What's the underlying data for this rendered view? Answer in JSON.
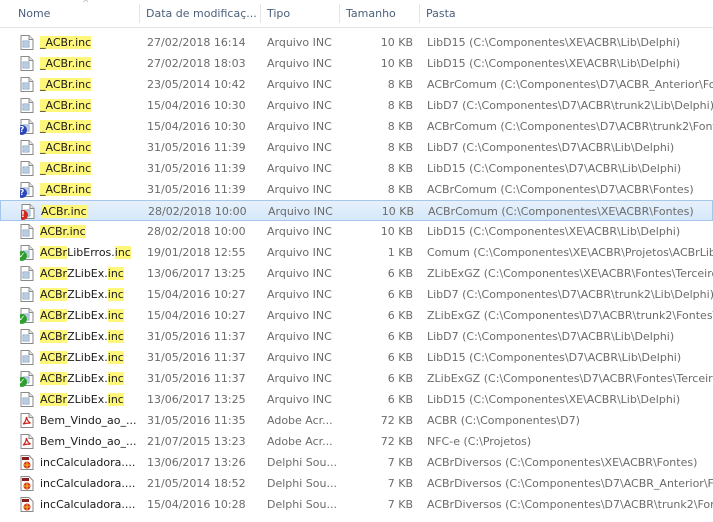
{
  "columns": {
    "name": "Nome",
    "date": "Data de modificaç...",
    "type": "Tipo",
    "size": "Tamanho",
    "path": "Pasta"
  },
  "rows": [
    {
      "pre": "",
      "hl": "_ACBr.inc",
      "post": "",
      "date": "27/02/2018 16:14",
      "type": "Arquivo INC",
      "size": "10 KB",
      "path": "LibD15 (C:\\Componentes\\XE\\ACBR\\Lib\\Delphi)",
      "icon": "inc-file-icon",
      "overlay": ""
    },
    {
      "pre": "",
      "hl": "_ACBr.inc",
      "post": "",
      "date": "27/02/2018 18:03",
      "type": "Arquivo INC",
      "size": "10 KB",
      "path": "LibD15 (C:\\Componentes\\XE\\ACBR\\Lib\\Delphi)",
      "icon": "inc-file-icon",
      "overlay": ""
    },
    {
      "pre": "",
      "hl": "_ACBr.inc",
      "post": "",
      "date": "23/05/2014 10:42",
      "type": "Arquivo INC",
      "size": "8 KB",
      "path": "ACBrComum (C:\\Componentes\\D7\\ACBR_Anterior\\Fontes)",
      "icon": "inc-file-icon",
      "overlay": ""
    },
    {
      "pre": "",
      "hl": "_ACBr.inc",
      "post": "",
      "date": "15/04/2016 10:30",
      "type": "Arquivo INC",
      "size": "8 KB",
      "path": "LibD7 (C:\\Componentes\\D7\\ACBR\\trunk2\\Lib\\Delphi)",
      "icon": "inc-file-icon",
      "overlay": ""
    },
    {
      "pre": "",
      "hl": "_ACBr.inc",
      "post": "",
      "date": "15/04/2016 10:30",
      "type": "Arquivo INC",
      "size": "8 KB",
      "path": "ACBrComum (C:\\Componentes\\D7\\ACBR\\trunk2\\Fontes)",
      "icon": "inc-file-icon",
      "overlay": "?"
    },
    {
      "pre": "",
      "hl": "_ACBr.inc",
      "post": "",
      "date": "31/05/2016 11:39",
      "type": "Arquivo INC",
      "size": "8 KB",
      "path": "LibD7 (C:\\Componentes\\D7\\ACBR\\Lib\\Delphi)",
      "icon": "inc-file-icon",
      "overlay": ""
    },
    {
      "pre": "",
      "hl": "_ACBr.inc",
      "post": "",
      "date": "31/05/2016 11:39",
      "type": "Arquivo INC",
      "size": "8 KB",
      "path": "LibD15 (C:\\Componentes\\D7\\ACBR\\Lib\\Delphi)",
      "icon": "inc-file-icon",
      "overlay": ""
    },
    {
      "pre": "",
      "hl": "_ACBr.inc",
      "post": "",
      "date": "31/05/2016 11:39",
      "type": "Arquivo INC",
      "size": "8 KB",
      "path": "ACBrComum (C:\\Componentes\\D7\\ACBR\\Fontes)",
      "icon": "inc-file-icon",
      "overlay": "?"
    },
    {
      "pre": "",
      "hl": "ACBr.inc",
      "post": "",
      "date": "28/02/2018 10:00",
      "type": "Arquivo INC",
      "size": "10 KB",
      "path": "ACBrComum (C:\\Componentes\\XE\\ACBR\\Fontes)",
      "icon": "inc-file-icon",
      "overlay": "!",
      "selected": true
    },
    {
      "pre": "",
      "hl": "ACBr.inc",
      "post": "",
      "date": "28/02/2018 10:00",
      "type": "Arquivo INC",
      "size": "10 KB",
      "path": "LibD15 (C:\\Componentes\\XE\\ACBR\\Lib\\Delphi)",
      "icon": "inc-file-icon",
      "overlay": ""
    },
    {
      "pre": "",
      "hl": "ACBr",
      "post": "LibErros.",
      "hl2": "inc",
      "date": "19/01/2018 12:55",
      "type": "Arquivo INC",
      "size": "1 KB",
      "path": "Comum (C:\\Componentes\\XE\\ACBR\\Projetos\\ACBrLib\\Fontes)",
      "icon": "inc-file-icon",
      "overlay": "✓"
    },
    {
      "pre": "",
      "hl": "ACBr",
      "post": "ZLibEx.",
      "hl2": "inc",
      "date": "13/06/2017 13:25",
      "type": "Arquivo INC",
      "size": "6 KB",
      "path": "ZLibExGZ (C:\\Componentes\\XE\\ACBR\\Fontes\\Terceiros)",
      "icon": "inc-file-icon",
      "overlay": ""
    },
    {
      "pre": "",
      "hl": "ACBr",
      "post": "ZLibEx.",
      "hl2": "inc",
      "date": "15/04/2016 10:27",
      "type": "Arquivo INC",
      "size": "6 KB",
      "path": "LibD7 (C:\\Componentes\\D7\\ACBR\\trunk2\\Lib\\Delphi)",
      "icon": "inc-file-icon",
      "overlay": ""
    },
    {
      "pre": "",
      "hl": "ACBr",
      "post": "ZLibEx.",
      "hl2": "inc",
      "date": "15/04/2016 10:27",
      "type": "Arquivo INC",
      "size": "6 KB",
      "path": "ZLibExGZ (C:\\Componentes\\D7\\ACBR\\trunk2\\Fontes\\Terceiros)",
      "icon": "inc-file-icon",
      "overlay": "✓"
    },
    {
      "pre": "",
      "hl": "ACBr",
      "post": "ZLibEx.",
      "hl2": "inc",
      "date": "31/05/2016 11:37",
      "type": "Arquivo INC",
      "size": "6 KB",
      "path": "LibD7 (C:\\Componentes\\D7\\ACBR\\Lib\\Delphi)",
      "icon": "inc-file-icon",
      "overlay": ""
    },
    {
      "pre": "",
      "hl": "ACBr",
      "post": "ZLibEx.",
      "hl2": "inc",
      "date": "31/05/2016 11:37",
      "type": "Arquivo INC",
      "size": "6 KB",
      "path": "LibD15 (C:\\Componentes\\D7\\ACBR\\Lib\\Delphi)",
      "icon": "inc-file-icon",
      "overlay": ""
    },
    {
      "pre": "",
      "hl": "ACBr",
      "post": "ZLibEx.",
      "hl2": "inc",
      "date": "31/05/2016 11:37",
      "type": "Arquivo INC",
      "size": "6 KB",
      "path": "ZLibExGZ (C:\\Componentes\\D7\\ACBR\\Fontes\\Terceiros)",
      "icon": "inc-file-icon",
      "overlay": "✓"
    },
    {
      "pre": "",
      "hl": "ACBr",
      "post": "ZLibEx.",
      "hl2": "inc",
      "date": "13/06/2017 13:25",
      "type": "Arquivo INC",
      "size": "6 KB",
      "path": "LibD15 (C:\\Componentes\\XE\\ACBR\\Lib\\Delphi)",
      "icon": "inc-file-icon",
      "overlay": ""
    },
    {
      "pre": "Bem_Vindo_ao_...",
      "hl": "",
      "post": "",
      "date": "31/05/2016 11:35",
      "type": "Adobe Acr...",
      "size": "72 KB",
      "path": "ACBR (C:\\Componentes\\D7)",
      "icon": "pdf-file-icon",
      "overlay": ""
    },
    {
      "pre": "Bem_Vindo_ao_...",
      "hl": "",
      "post": "",
      "date": "21/07/2015 13:23",
      "type": "Adobe Acr...",
      "size": "72 KB",
      "path": "NFC-e (C:\\Projetos)",
      "icon": "pdf-file-icon",
      "overlay": ""
    },
    {
      "pre": "incCalculadora....",
      "hl": "",
      "post": "",
      "date": "13/06/2017 13:26",
      "type": "Delphi Sou...",
      "size": "7 KB",
      "path": "ACBrDiversos (C:\\Componentes\\XE\\ACBR\\Fontes)",
      "icon": "delphi-source-icon",
      "overlay": ""
    },
    {
      "pre": "incCalculadora....",
      "hl": "",
      "post": "",
      "date": "21/05/2014 18:52",
      "type": "Delphi Sou...",
      "size": "7 KB",
      "path": "ACBrDiversos (C:\\Componentes\\D7\\ACBR_Anterior\\Fontes)",
      "icon": "delphi-source-icon",
      "overlay": ""
    },
    {
      "pre": "incCalculadora....",
      "hl": "",
      "post": "",
      "date": "15/04/2016 10:28",
      "type": "Delphi Sou...",
      "size": "7 KB",
      "path": "ACBrDiversos (C:\\Componentes\\D7\\ACBR\\trunk2\\Fontes)",
      "icon": "delphi-source-icon",
      "overlay": ""
    }
  ]
}
